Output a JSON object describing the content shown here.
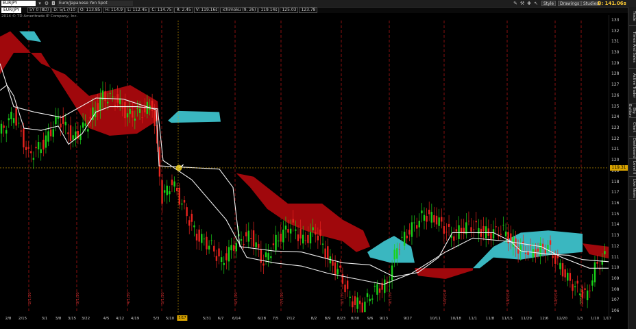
{
  "toolbar": {
    "symbol": "EURJPY",
    "description": "Euro/Japanese Yen Spot",
    "style_label": "Style",
    "drawings_label": "Drawings",
    "studies_label": "Studies",
    "price_readout": "B: 141.06s"
  },
  "info_bar": {
    "pair": "EUR/JPY",
    "ohlc": [
      "5Y 0 (8D)",
      "D: 5/17/10",
      "O: 113.85",
      "H: 114.9",
      "L: 112.45",
      "C: 114.75",
      "R: 2.45",
      "V: 119.16s",
      "ichimoku (9, 26)",
      "119.14s",
      "125.03",
      "123.78"
    ]
  },
  "watermark": "2014 © TD Ameritrade IP Company, Inc.",
  "price_axis": {
    "ticks": [
      "133",
      "132",
      "131",
      "130",
      "129",
      "128",
      "127",
      "126",
      "125",
      "124",
      "123",
      "122",
      "121",
      "120",
      "119",
      "118",
      "117",
      "116",
      "115",
      "114",
      "113",
      "112",
      "111",
      "110",
      "109",
      "108",
      "107",
      "106"
    ],
    "current_price": "119.31"
  },
  "time_axis": {
    "ticks": [
      "2/8",
      "2/15",
      "3/1",
      "3/8",
      "3/15",
      "3/22",
      "4/5",
      "4/12",
      "4/19",
      "5/3",
      "5/10",
      "5/31",
      "6/7",
      "6/14",
      "6/28",
      "7/5",
      "7/12",
      "8/2",
      "8/9",
      "8/23",
      "8/30",
      "9/6",
      "9/13",
      "9/27",
      "10/11",
      "10/18",
      "11/1",
      "11/8",
      "11/15",
      "11/29",
      "12/6",
      "12/20",
      "1/3",
      "1/10",
      "1/17"
    ],
    "badge": "5/17"
  },
  "markers": [
    "2/1/10",
    "3/1/10",
    "4/1/10",
    "5/1/10",
    "6/1/10",
    "7/1/10",
    "8/1/10",
    "9/1/10",
    "10/1/10",
    "11/1/10",
    "12/1/10",
    "2010 year"
  ],
  "side_tabs": [
    "Trade",
    "Times And Sales",
    "Active Trader",
    "Big Buttons",
    "Chart",
    "Dashboard",
    "Level II",
    "Live News"
  ],
  "colors": {
    "bullish_candle": "#19d219",
    "bearish_candle": "#e8231e",
    "cloud_bearish": "#a0080c",
    "cloud_bullish": "#3ab7c0",
    "ichimoku_line": "#f2f2f2",
    "marker_line": "#c01818",
    "crosshair": "#d9a400"
  },
  "chart_data": {
    "type": "candlestick",
    "instrument": "EUR/JPY",
    "period": "5Y",
    "aggregation": "1 day",
    "ylim": [
      105.5,
      133.5
    ],
    "study": "ichimoku (9, 26)",
    "key_prices": [
      {
        "date": "2/8",
        "close": 122.5
      },
      {
        "date": "3/1",
        "close": 121.0
      },
      {
        "date": "4/5",
        "close": 125.5
      },
      {
        "date": "4/19",
        "close": 125.0
      },
      {
        "date": "5/3",
        "close": 121.0
      },
      {
        "date": "5/10",
        "close": 117.0
      },
      {
        "date": "6/7",
        "close": 110.5
      },
      {
        "date": "7/12",
        "close": 112.5
      },
      {
        "date": "8/9",
        "close": 112.5
      },
      {
        "date": "8/23",
        "close": 107.0
      },
      {
        "date": "9/13",
        "close": 108.5
      },
      {
        "date": "9/27",
        "close": 114.0
      },
      {
        "date": "11/8",
        "close": 114.5
      },
      {
        "date": "12/6",
        "close": 111.0
      },
      {
        "date": "12/20",
        "close": 109.0
      },
      {
        "date": "1/10",
        "close": 107.5
      },
      {
        "date": "1/17",
        "close": 110.5
      }
    ],
    "current_price": 119.31
  }
}
